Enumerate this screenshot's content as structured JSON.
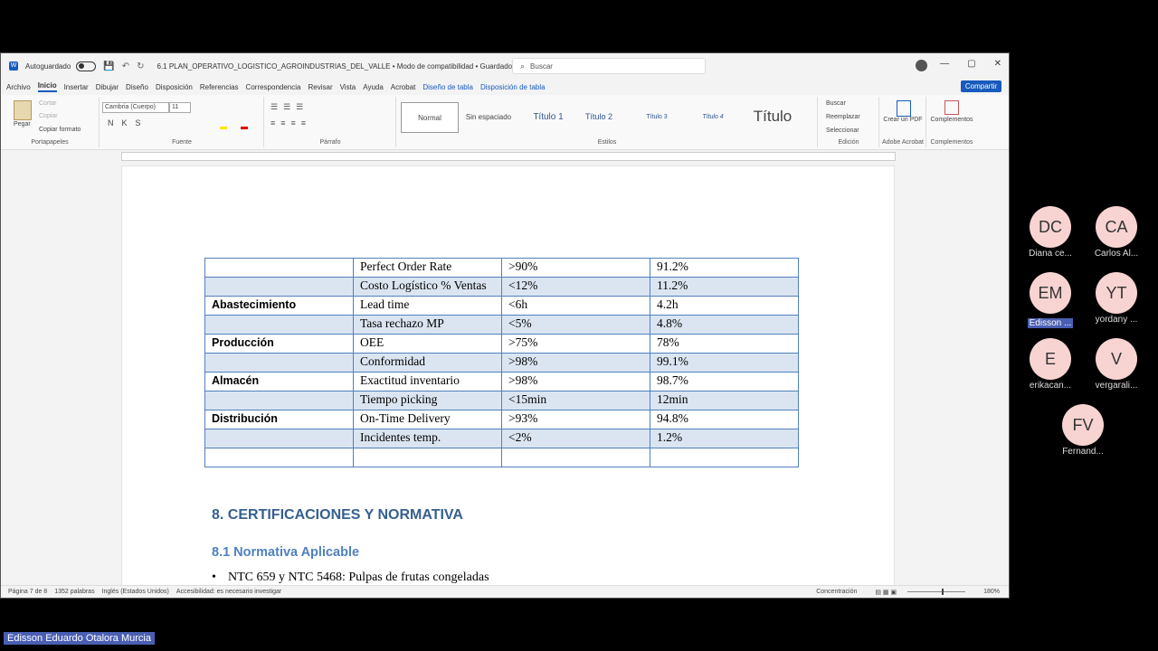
{
  "window": {
    "title": "6.1 PLAN_OPERATIVO_LOGISTICO_AGROINDUSTRIAS_DEL_VALLE  •  Modo de compatibilidad  •  Guardado",
    "autosave_label": "Autoguardado",
    "search_placeholder": "Buscar",
    "controls": [
      "—",
      "▢",
      "✕"
    ]
  },
  "tabs": [
    "Archivo",
    "Inicio",
    "Insertar",
    "Dibujar",
    "Diseño",
    "Disposición",
    "Referencias",
    "Correspondencia",
    "Revisar",
    "Vista",
    "Ayuda",
    "Acrobat",
    "Diseño de tabla",
    "Disposición de tabla"
  ],
  "share_label": "Compartir",
  "ribbon": {
    "clipboard": {
      "paste": "Pegar",
      "cut": "Cortar",
      "copy": "Copiar",
      "format_painter": "Copiar formato",
      "label": "Portapapeles"
    },
    "font": {
      "name": "Cambria (Cuerpo)",
      "size": "11",
      "label": "Fuente"
    },
    "paragraph": {
      "label": "Párrafo"
    },
    "styles": {
      "items": [
        "Normal",
        "Sin espaciado",
        "Título 1",
        "Título 2",
        "Título 3",
        "Título 4",
        "Título"
      ],
      "label": "Estilos"
    },
    "editing": {
      "find": "Buscar",
      "replace": "Reemplazar",
      "select": "Seleccionar",
      "label": "Edición"
    },
    "acrobat": {
      "create_pdf": "Crear un PDF",
      "label": "Adobe Acrobat"
    },
    "addins": {
      "name": "Complementos",
      "label": "Complementos"
    }
  },
  "table": {
    "rows": [
      {
        "area": "",
        "kpi": "Perfect Order Rate",
        "target": ">90%",
        "actual": "91.2%"
      },
      {
        "area": "",
        "kpi": "Costo Logístico % Ventas",
        "target": "<12%",
        "actual": "11.2%"
      },
      {
        "area": "Abastecimiento",
        "kpi": "Lead time",
        "target": "<6h",
        "actual": "4.2h"
      },
      {
        "area": "",
        "kpi": "Tasa rechazo MP",
        "target": "<5%",
        "actual": "4.8%"
      },
      {
        "area": "Producción",
        "kpi": "OEE",
        "target": ">75%",
        "actual": "78%"
      },
      {
        "area": "",
        "kpi": "Conformidad",
        "target": ">98%",
        "actual": "99.1%"
      },
      {
        "area": "Almacén",
        "kpi": "Exactitud inventario",
        "target": ">98%",
        "actual": "98.7%"
      },
      {
        "area": "",
        "kpi": "Tiempo picking",
        "target": "<15min",
        "actual": "12min"
      },
      {
        "area": "Distribución",
        "kpi": "On-Time Delivery",
        "target": ">93%",
        "actual": "94.8%"
      },
      {
        "area": "",
        "kpi": "Incidentes temp.",
        "target": "<2%",
        "actual": "1.2%"
      },
      {
        "area": "",
        "kpi": "",
        "target": "",
        "actual": ""
      }
    ]
  },
  "document": {
    "heading1": "8. CERTIFICACIONES Y NORMATIVA",
    "heading2": "8.1 Normativa Aplicable",
    "bullet1": "NTC 659 y NTC 5468: Pulpas de frutas congeladas"
  },
  "status": {
    "page": "Página 7 de 8",
    "words": "1352 palabras",
    "language": "Inglés (Estados Unidos)",
    "accessibility": "Accesibilidad: es necesario investigar",
    "focus": "Concentración",
    "zoom": "180%"
  },
  "participants": [
    {
      "initials": "DC",
      "name": "Diana ce..."
    },
    {
      "initials": "CA",
      "name": "Carlos Al..."
    },
    {
      "initials": "EM",
      "name": "Edisson ..."
    },
    {
      "initials": "YT",
      "name": "yordany ..."
    },
    {
      "initials": "E",
      "name": "erikacan..."
    },
    {
      "initials": "V",
      "name": "vergarali..."
    },
    {
      "initials": "FV",
      "name": "Fernand..."
    }
  ],
  "presenter": "Edisson Eduardo Otalora Murcia"
}
